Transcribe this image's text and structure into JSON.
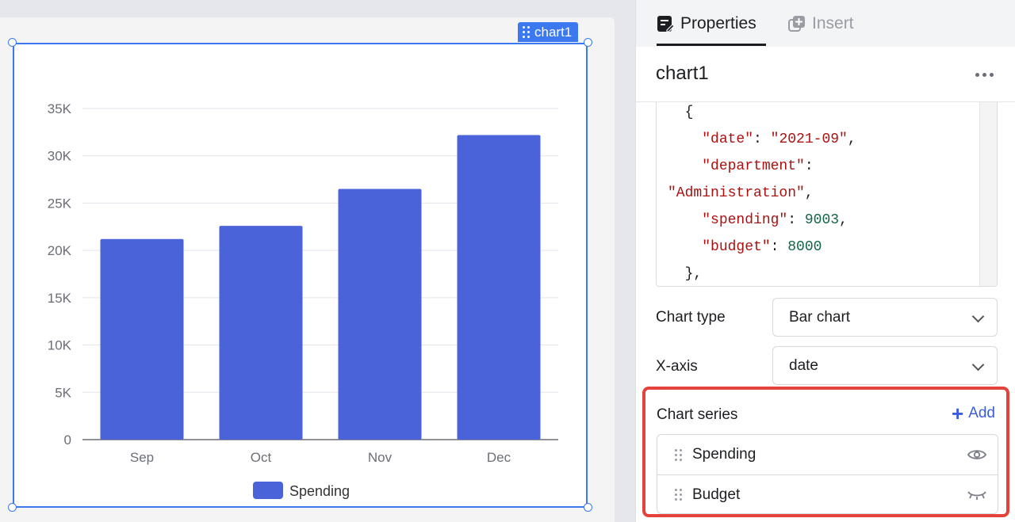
{
  "component": {
    "tag_label": "chart1",
    "name": "chart1"
  },
  "tabs": [
    {
      "label": "Properties",
      "active": true
    },
    {
      "label": "Insert",
      "active": false
    }
  ],
  "code_editor": {
    "lines": [
      [
        {
          "t": "p",
          "v": "  {"
        }
      ],
      [
        {
          "t": "p",
          "v": "    "
        },
        {
          "t": "s",
          "v": "\"date\""
        },
        {
          "t": "p",
          "v": ": "
        },
        {
          "t": "s",
          "v": "\"2021-09\""
        },
        {
          "t": "p",
          "v": ","
        }
      ],
      [
        {
          "t": "p",
          "v": "    "
        },
        {
          "t": "s",
          "v": "\"department\""
        },
        {
          "t": "p",
          "v": ":"
        }
      ],
      [
        {
          "t": "s",
          "v": "\"Administration\""
        },
        {
          "t": "p",
          "v": ","
        }
      ],
      [
        {
          "t": "p",
          "v": "    "
        },
        {
          "t": "s",
          "v": "\"spending\""
        },
        {
          "t": "p",
          "v": ": "
        },
        {
          "t": "n",
          "v": "9003"
        },
        {
          "t": "p",
          "v": ","
        }
      ],
      [
        {
          "t": "p",
          "v": "    "
        },
        {
          "t": "s",
          "v": "\"budget\""
        },
        {
          "t": "p",
          "v": ": "
        },
        {
          "t": "n",
          "v": "8000"
        }
      ],
      [
        {
          "t": "p",
          "v": "  },"
        }
      ]
    ]
  },
  "fields": {
    "chart_type": {
      "label": "Chart type",
      "value": "Bar chart"
    },
    "x_axis": {
      "label": "X-axis",
      "value": "date"
    }
  },
  "chart_series": {
    "title": "Chart series",
    "add_label": "Add",
    "items": [
      {
        "name": "Spending",
        "visible": true
      },
      {
        "name": "Budget",
        "visible": false
      }
    ]
  },
  "colors": {
    "bar": "#4a63d9",
    "selection": "#3c78f0",
    "highlight": "#e5423c"
  },
  "chart_data": {
    "type": "bar",
    "categories": [
      "Sep",
      "Oct",
      "Nov",
      "Dec"
    ],
    "series": [
      {
        "name": "Spending",
        "values": [
          21200,
          22600,
          26500,
          32200
        ]
      }
    ],
    "ylim": [
      0,
      35000
    ],
    "yticks": [
      0,
      5000,
      10000,
      15000,
      20000,
      25000,
      30000,
      35000
    ],
    "ytick_labels": [
      "0",
      "5K",
      "10K",
      "15K",
      "20K",
      "25K",
      "30K",
      "35K"
    ],
    "grid": true,
    "legend": "bottom"
  }
}
